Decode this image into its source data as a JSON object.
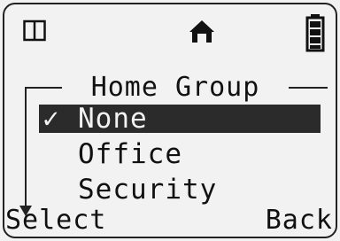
{
  "status_bar": {
    "left_icon": "book-icon",
    "center_icon": "home-icon",
    "right_icon": "battery-icon"
  },
  "group": {
    "title": "Home Group"
  },
  "menu": {
    "items": [
      {
        "label": "None",
        "selected": true,
        "checked": true
      },
      {
        "label": "Office",
        "selected": false,
        "checked": false
      },
      {
        "label": "Security",
        "selected": false,
        "checked": false
      }
    ],
    "check_glyph": "✓"
  },
  "softkeys": {
    "left": "Select",
    "right": "Back"
  },
  "colors": {
    "background": "#f2f2f2",
    "foreground": "#111111",
    "highlight": "#2b2b2b"
  }
}
